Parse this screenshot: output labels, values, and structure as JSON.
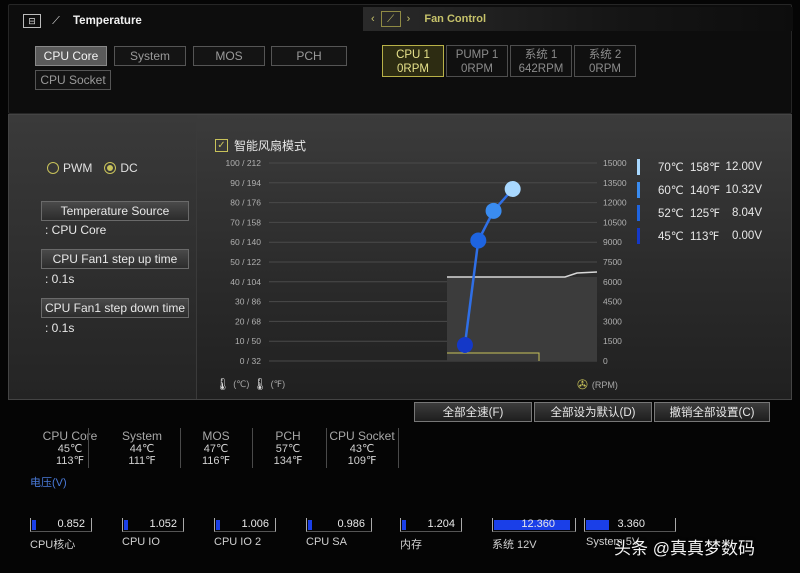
{
  "header": {
    "left_title": "Temperature",
    "right_title": "Fan Control"
  },
  "temp_tabs": [
    {
      "label": "CPU Core",
      "active": true
    },
    {
      "label": "System",
      "active": false
    },
    {
      "label": "MOS",
      "active": false
    },
    {
      "label": "PCH",
      "active": false
    },
    {
      "label": "CPU Socket",
      "active": false
    }
  ],
  "fan_tabs": [
    {
      "name": "CPU 1",
      "rpm": "0RPM",
      "active": true
    },
    {
      "name": "PUMP 1",
      "rpm": "0RPM",
      "active": false
    },
    {
      "name": "系统 1",
      "rpm": "642RPM",
      "active": false
    },
    {
      "name": "系统 2",
      "rpm": "0RPM",
      "active": false
    }
  ],
  "mode": {
    "pwm_label": "PWM",
    "dc_label": "DC",
    "selected": "DC"
  },
  "settings": {
    "temp_source_label": "Temperature Source",
    "temp_source_value": ": CPU Core",
    "step_up_label": "CPU Fan1 step up time",
    "step_up_value": ": 0.1s",
    "step_down_label": "CPU Fan1 step down time",
    "step_down_value": ": 0.1s"
  },
  "smart_fan": {
    "label": "智能风扇模式",
    "checked": true
  },
  "chart_data": {
    "type": "line",
    "y_left_ticks": [
      "100 / 212",
      "90 / 194",
      "80 / 176",
      "70 / 158",
      "60 / 140",
      "50 / 122",
      "40 / 104",
      "30 /  86",
      "20 /  68",
      "10 /  50",
      "0 /  32"
    ],
    "y_right_ticks": [
      "15000",
      "13500",
      "12000",
      "10500",
      "9000",
      "7500",
      "6000",
      "4500",
      "3000",
      "1500",
      "0"
    ],
    "y_left_range": [
      0,
      100
    ],
    "y_right_range": [
      0,
      15000
    ],
    "curve_points": [
      {
        "temp_c": 45,
        "volt": 0.0
      },
      {
        "temp_c": 52,
        "volt": 8.04
      },
      {
        "temp_c": 60,
        "volt": 10.32
      },
      {
        "temp_c": 70,
        "volt": 12.0
      }
    ],
    "point_colors": [
      "#1438c8",
      "#1e64e0",
      "#3a8cf0",
      "#a8d8ff"
    ],
    "unit_left_c": "(℃)",
    "unit_left_f": "(℉)",
    "unit_right": "(RPM)",
    "grid": true
  },
  "legend": [
    {
      "c": "70℃",
      "f": "158℉",
      "v": "12.00V",
      "color": "#a8d8ff"
    },
    {
      "c": "60℃",
      "f": "140℉",
      "v": "10.32V",
      "color": "#3a8cf0"
    },
    {
      "c": "52℃",
      "f": "125℉",
      "v": "8.04V",
      "color": "#1e64e0"
    },
    {
      "c": "45℃",
      "f": "113℉",
      "v": "0.00V",
      "color": "#1438c8"
    }
  ],
  "actions": {
    "full_speed": "全部全速(F)",
    "set_default": "全部设为默认(D)",
    "undo_all": "撤销全部设置(C)"
  },
  "temps": [
    {
      "name": "CPU Core",
      "c": "45℃",
      "f": "113℉"
    },
    {
      "name": "System",
      "c": "44℃",
      "f": "111℉"
    },
    {
      "name": "MOS",
      "c": "47℃",
      "f": "116℉"
    },
    {
      "name": "PCH",
      "c": "57℃",
      "f": "134℉"
    },
    {
      "name": "CPU Socket",
      "c": "43℃",
      "f": "109℉"
    }
  ],
  "voltage": {
    "title": "电压(V)",
    "items": [
      {
        "name": "CPU核心",
        "value": "0.852",
        "fill": 0.07
      },
      {
        "name": "CPU IO",
        "value": "1.052",
        "fill": 0.07
      },
      {
        "name": "CPU IO 2",
        "value": "1.006",
        "fill": 0.07
      },
      {
        "name": "CPU SA",
        "value": "0.986",
        "fill": 0.07
      },
      {
        "name": "内存",
        "value": "1.204",
        "fill": 0.07
      },
      {
        "name": "系统 12V",
        "value": "12.360",
        "fill": 0.93
      },
      {
        "name": "System 5V",
        "value": "3.360",
        "fill": 0.25
      }
    ]
  },
  "watermark": "头条 @真真梦数码"
}
